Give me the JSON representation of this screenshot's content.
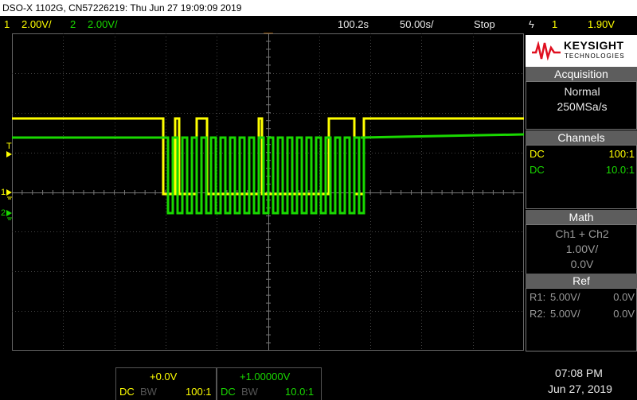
{
  "title_bar": "DSO-X 1102G, CN57226219: Thu Jun 27 19:09:09 2019",
  "top_bar": {
    "ch1_num": "1",
    "ch1_scale": "2.00V/",
    "ch2_num": "2",
    "ch2_scale": "2.00V/",
    "time_position": "100.2s",
    "timebase": "50.00s/",
    "run_state": "Stop",
    "trigger_symbol": "ϟ",
    "trigger_channel": "1",
    "trigger_level": "1.90V"
  },
  "markers": {
    "trigger_T": "T",
    "ch1_ground": "1",
    "ch2_ground": "2"
  },
  "logo": {
    "brand": "KEYSIGHT",
    "sub": "TECHNOLOGIES"
  },
  "acquisition": {
    "header": "Acquisition",
    "mode": "Normal",
    "rate": "250MSa/s"
  },
  "channels": {
    "header": "Channels",
    "rows": [
      {
        "coupling": "DC",
        "probe": "100:1",
        "color": "#ffff00"
      },
      {
        "coupling": "DC",
        "probe": "10.0:1",
        "color": "#19d800"
      }
    ]
  },
  "math": {
    "header": "Math",
    "function": "Ch1 + Ch2",
    "scale": "1.00V/",
    "offset": "0.0V"
  },
  "ref": {
    "header": "Ref",
    "rows": [
      {
        "name": "R1:",
        "scale": "5.00V/",
        "offset": "0.0V"
      },
      {
        "name": "R2:",
        "scale": "5.00V/",
        "offset": "0.0V"
      }
    ]
  },
  "bottom": {
    "ch1_offset": "+0.0V",
    "ch1_coupling": "DC",
    "ch1_bw": "BW",
    "ch1_probe": "100:1",
    "ch2_offset": "+1.00000V",
    "ch2_coupling": "DC",
    "ch2_bw": "BW",
    "ch2_probe": "10.0:1",
    "time": "07:08 PM",
    "date": "Jun 27, 2019"
  },
  "colors": {
    "ch1": "#ffff00",
    "ch2": "#19d800",
    "trigger_marker": "#ff8c00",
    "brand_red": "#e01020"
  }
}
